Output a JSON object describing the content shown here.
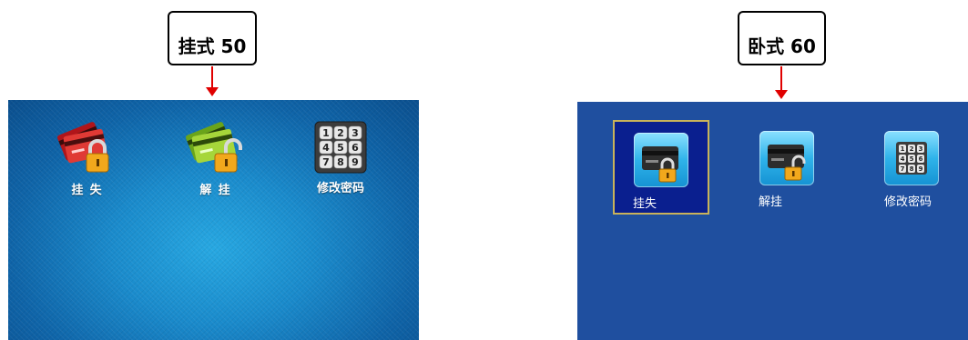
{
  "callouts": {
    "left": "挂式 50",
    "right": "卧式 60"
  },
  "left_screen": {
    "items": [
      {
        "label": "挂  失",
        "icon": "credit-card-lock-icon"
      },
      {
        "label": "解  挂",
        "icon": "credit-card-unlock-icon"
      },
      {
        "label": "修改密码",
        "icon": "keypad-icon"
      }
    ],
    "keypad_digits": [
      "1",
      "2",
      "3",
      "4",
      "5",
      "6",
      "7",
      "8",
      "9"
    ]
  },
  "right_screen": {
    "items": [
      {
        "label": "挂失",
        "icon": "card-lock-icon",
        "selected": true
      },
      {
        "label": "解挂",
        "icon": "card-unlock-icon",
        "selected": false
      },
      {
        "label": "修改密码",
        "icon": "keypad-icon",
        "selected": false
      }
    ],
    "keypad_digits": [
      "1",
      "2",
      "3",
      "4",
      "5",
      "6",
      "7",
      "8",
      "9"
    ]
  },
  "colors": {
    "arrow": "#e00000",
    "left_screen_bg": "#1a8bcc",
    "right_screen_bg": "#1f4f9f",
    "selection_bg": "#0a1f8f",
    "selection_border": "#c9b25a"
  }
}
